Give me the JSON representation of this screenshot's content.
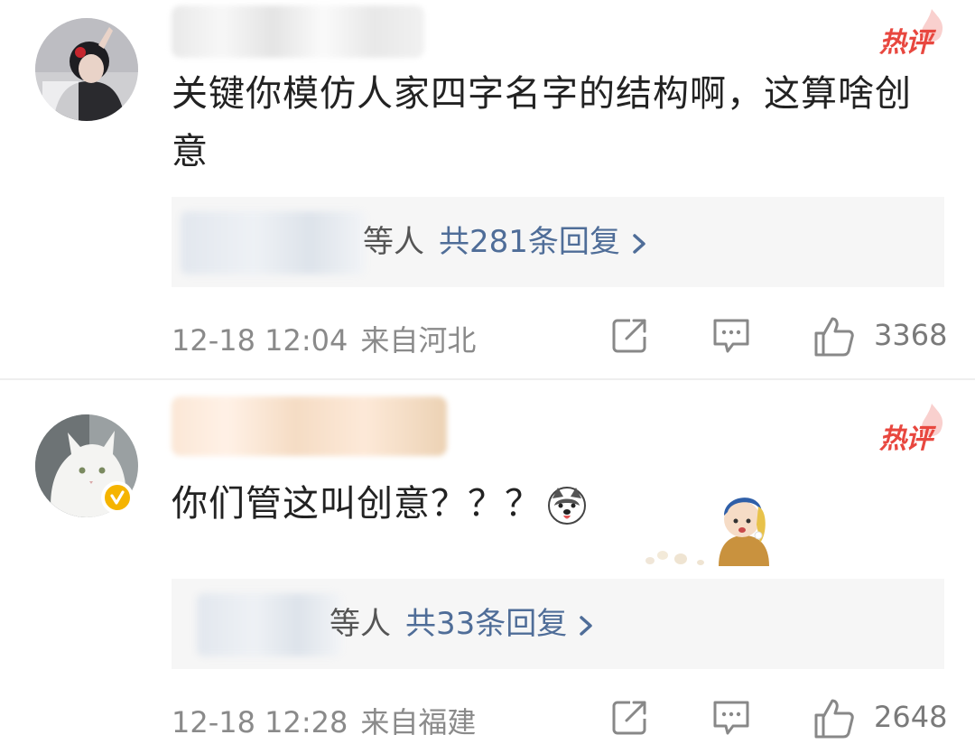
{
  "badge_hot": "热评",
  "comments": [
    {
      "text": "关键你模仿人家四字名字的结构啊，这算啥创意",
      "reply_suffix": "等人",
      "reply_count": "共281条回复",
      "reply_arrow": "›",
      "time": "12-18 12:04",
      "location": "来自河北",
      "likes": "3368"
    },
    {
      "text": "你们管这叫创意？？？",
      "reply_suffix": "等人",
      "reply_count": "共33条回复",
      "reply_arrow": "›",
      "time": "12-18 12:28",
      "location": "来自福建",
      "likes": "2648"
    }
  ],
  "icons": {
    "share": "share-icon",
    "comment": "comment-icon",
    "like": "thumbs-up-icon",
    "verified": "verified-badge-icon",
    "emoji": "husky-emoji-icon"
  },
  "colors": {
    "hot": "#e8473f",
    "link": "#4f6d98",
    "meta": "#8a8a8a",
    "reply_bg": "#f6f6f6",
    "verified": "#f5b400"
  }
}
